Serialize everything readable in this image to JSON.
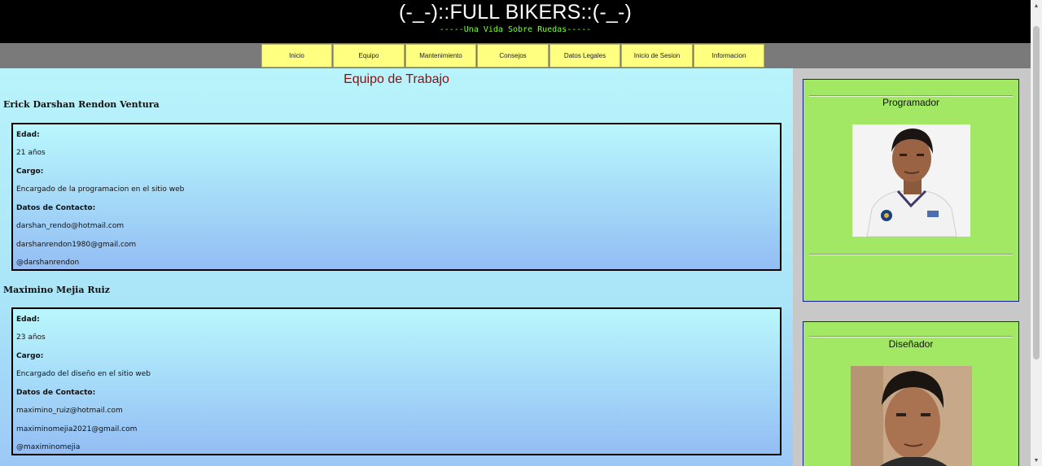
{
  "header": {
    "title": "(-_-)::FULL BIKERS::(-_-)",
    "tagline": "-----Una Vida Sobre Ruedas-----"
  },
  "nav": {
    "items": [
      {
        "label": "Inicio"
      },
      {
        "label": "Equipo"
      },
      {
        "label": "Mantenimiento"
      },
      {
        "label": "Consejos"
      },
      {
        "label": "Datos Legales"
      },
      {
        "label": "Inicio de Sesion"
      },
      {
        "label": "Informacion"
      }
    ]
  },
  "main": {
    "title": "Equipo de Trabajo",
    "members": [
      {
        "name": "Erick Darshan Rendon Ventura",
        "age_label": "Edad:",
        "age": "21 años",
        "role_label": "Cargo:",
        "role": "Encargado de la programacion en el sitio web",
        "contact_label": "Datos de Contacto:",
        "email1": "darshan_rendo@hotmail.com",
        "email2": "darshanrendon1980@gmail.com",
        "handle": "@darshanrendon"
      },
      {
        "name": "Maximino Mejia Ruiz",
        "age_label": "Edad:",
        "age": "23 años",
        "role_label": "Cargo:",
        "role": "Encargado del diseño en el sitio web",
        "contact_label": "Datos de Contacto:",
        "email1": "maximino_ruiz@hotmail.com",
        "email2": "maximinomejia2021@gmail.com",
        "handle": "@maximinomejia"
      }
    ]
  },
  "sidebar": {
    "roles": [
      {
        "title": "Programador"
      },
      {
        "title": "Diseñador"
      }
    ]
  },
  "colors": {
    "header_bg": "#000000",
    "tagline": "#7fff3a",
    "nav_button": "#ffff80",
    "main_title": "#8b0f0f",
    "sidebar_box": "#a2e864"
  }
}
